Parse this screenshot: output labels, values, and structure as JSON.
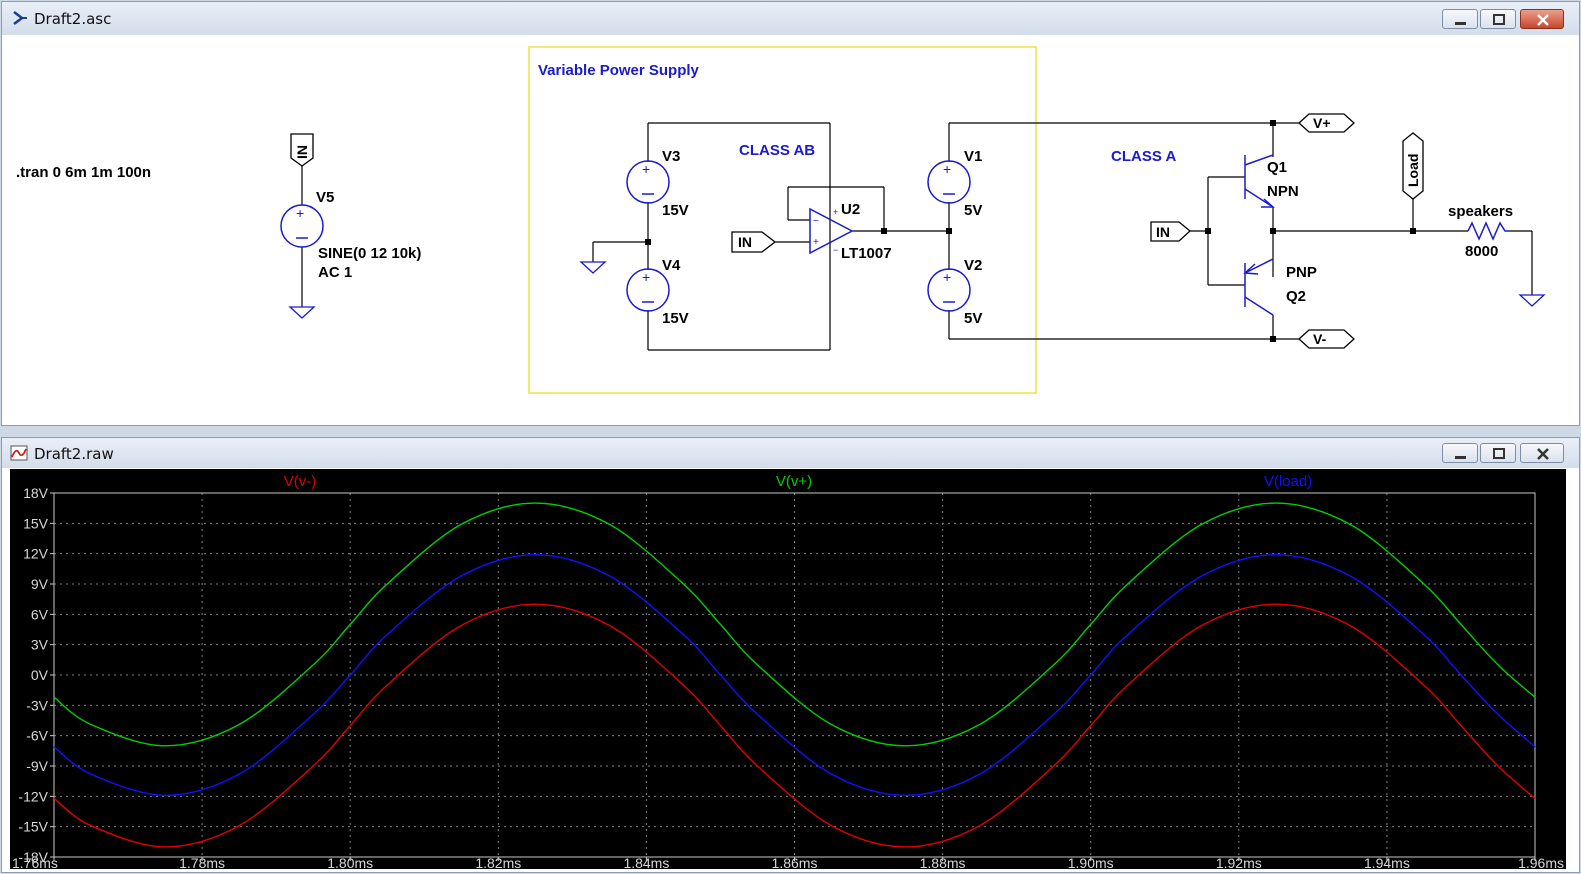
{
  "schematic_window": {
    "title": "Draft2.asc",
    "directive": ".tran 0 6m 1m 100n",
    "box_title": "Variable Power Supply",
    "class_ab": "CLASS AB",
    "class_a": "CLASS A",
    "components": {
      "v5_name": "V5",
      "v5_value1": "SINE(0 12 10k)",
      "v5_value2": "AC 1",
      "v3_name": "V3",
      "v3_value": "15V",
      "v4_name": "V4",
      "v4_value": "15V",
      "u2_name": "U2",
      "u2_value": "LT1007",
      "v1_name": "V1",
      "v1_value": "5V",
      "v2_name": "V2",
      "v2_value": "5V",
      "q1_name": "Q1",
      "q1_value": "NPN",
      "q2_name": "Q2",
      "q2_value": "PNP",
      "r_name": "speakers",
      "r_value": "8000"
    },
    "net_labels": {
      "in_v5": "IN",
      "in_u2": "IN",
      "in_q": "IN",
      "vplus": "V+",
      "vminus": "V-",
      "load": "Load"
    }
  },
  "waveform_window": {
    "title": "Draft2.raw",
    "traces": [
      {
        "name": "V(v-)",
        "color": "#e00000"
      },
      {
        "name": "V(v+)",
        "color": "#00d000"
      },
      {
        "name": "V(load)",
        "color": "#1010ff"
      }
    ]
  },
  "chart_data": {
    "type": "line",
    "xlabel": "",
    "ylabel": "",
    "xlim": [
      1.76,
      1.96
    ],
    "ylim": [
      -18,
      18
    ],
    "x_ticks": [
      "1.76ms",
      "1.78ms",
      "1.80ms",
      "1.82ms",
      "1.84ms",
      "1.86ms",
      "1.88ms",
      "1.90ms",
      "1.92ms",
      "1.94ms",
      "1.96ms"
    ],
    "y_ticks": [
      "18V",
      "15V",
      "12V",
      "9V",
      "6V",
      "3V",
      "0V",
      "-3V",
      "-6V",
      "-9V",
      "-12V",
      "-15V",
      "-18V"
    ],
    "grid": true,
    "x": [
      1.76,
      1.765,
      1.775,
      1.785,
      1.795,
      1.8,
      1.805,
      1.815,
      1.825,
      1.835,
      1.845,
      1.85,
      1.855,
      1.865,
      1.875,
      1.885,
      1.895,
      1.9,
      1.905,
      1.915,
      1.925,
      1.935,
      1.945,
      1.95,
      1.955,
      1.96
    ],
    "series": [
      {
        "name": "V(v-)",
        "color": "#e00000",
        "values": [
          -12.2,
          -14.9,
          -17,
          -14.9,
          -9,
          -5,
          -1,
          4.9,
          7,
          4.9,
          -1,
          -5,
          -9,
          -14.9,
          -17,
          -14.9,
          -9,
          -5,
          -1,
          4.9,
          7,
          4.9,
          -1,
          -5,
          -9,
          -12.2
        ]
      },
      {
        "name": "V(v+)",
        "color": "#00d000",
        "values": [
          -2.2,
          -4.9,
          -7,
          -4.9,
          1,
          5,
          9,
          14.9,
          17,
          14.9,
          9,
          5,
          1,
          -4.9,
          -7,
          -4.9,
          1,
          5,
          9,
          14.9,
          17,
          14.9,
          9,
          5,
          1,
          -2.2
        ]
      },
      {
        "name": "V(load)",
        "color": "#1010ff",
        "values": [
          -7.1,
          -9.8,
          -11.9,
          -9.8,
          -3.9,
          0,
          4,
          9.8,
          11.9,
          9.8,
          4,
          0,
          -3.9,
          -9.8,
          -11.9,
          -9.8,
          -3.9,
          0,
          4,
          9.8,
          11.9,
          9.8,
          4,
          0,
          -3.9,
          -7.1
        ]
      }
    ]
  }
}
